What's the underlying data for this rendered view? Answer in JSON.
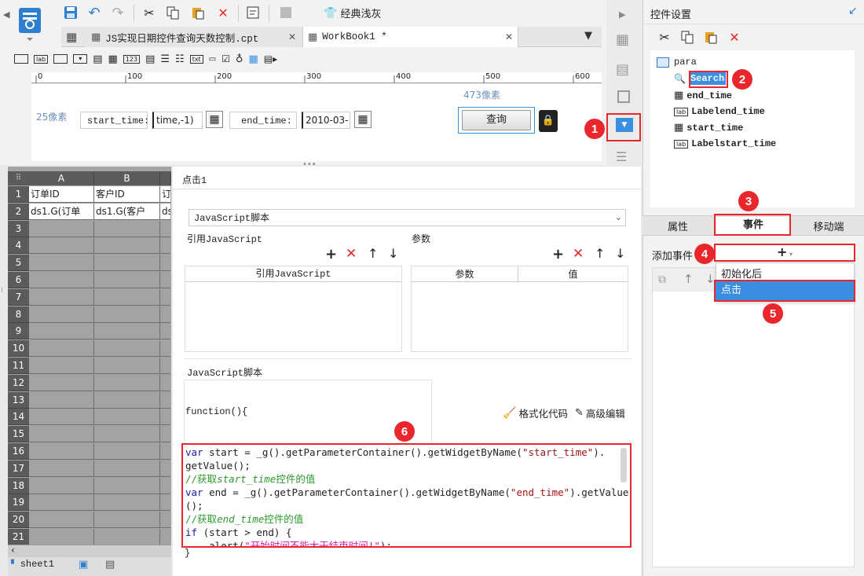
{
  "toolbar": {
    "classic_theme": "经典浅灰"
  },
  "tabs": [
    {
      "label": "JS实现日期控件查询天数控制.cpt",
      "close": "✕"
    },
    {
      "label": "WorkBook1 *",
      "close": "✕"
    }
  ],
  "ruler": {
    "ticks": [
      "0",
      "100",
      "200",
      "300",
      "400",
      "500",
      "600"
    ],
    "left_px": "25像素",
    "right_px": "473像素"
  },
  "params": {
    "start_label": "start_time:",
    "start_value": "time,-1)",
    "end_label": "end_time:",
    "end_value": "2010-03-",
    "query_button": "查询"
  },
  "sheet": {
    "col_headers": [
      "A",
      "B"
    ],
    "rows": [
      {
        "num": "1",
        "a": "订单ID",
        "b": "客户ID",
        "c": "订"
      },
      {
        "num": "2",
        "a": "ds1.G(订单",
        "b": "ds1.G(客户",
        "c": "ds"
      }
    ],
    "empty_rows": [
      "3",
      "4",
      "5",
      "6",
      "7",
      "8",
      "9",
      "10",
      "11",
      "12",
      "13",
      "14",
      "15",
      "16",
      "17",
      "18",
      "19",
      "20",
      "21"
    ],
    "sheet_tab": "sheet1"
  },
  "event_panel": {
    "title": "点击1",
    "script_type": "JavaScript脚本",
    "ref_js_label": "引用JavaScript",
    "params_label": "参数",
    "ref_js_col": "引用JavaScript",
    "param_col": "参数",
    "value_col": "值",
    "script_label": "JavaScript脚本",
    "function_head": "function(){",
    "format_code": "格式化代码",
    "advanced_edit": "高级编辑",
    "code": {
      "l1_kw": "var",
      "l1_a": " start = _g().getParameterContainer().getWidgetByName(",
      "l1_str": "\"start_time\"",
      "l1_b": ").",
      "l2": "getValue();",
      "l3_a": "//获取",
      "l3_b": "start_time",
      "l3_c": "控件的值",
      "l4_kw": "var",
      "l4_a": " end = _g().getParameterContainer().getWidgetByName(",
      "l4_str": "\"end_time\"",
      "l4_b": ").getValue",
      "l5": "();",
      "l6_a": "//获取",
      "l6_b": "end_time",
      "l6_c": "控件的值",
      "l7_kw": "if",
      "l7_a": " (start > end) {",
      "l8_a": "    alert(",
      "l8_str": "\"开始时间不能大于结束时间!\"",
      "l8_b": ");"
    },
    "closing_brace": "}"
  },
  "right_panel": {
    "title": "控件设置",
    "tree": {
      "root": "para",
      "items": [
        "Search",
        "end_time",
        "Labelend_time",
        "start_time",
        "Labelstart_time"
      ]
    },
    "tabs": [
      "属性",
      "事件",
      "移动端"
    ],
    "add_event_label": "添加事件",
    "add_symbol": "+",
    "dropdown_items": [
      "初始化后",
      "点击"
    ]
  },
  "annotations": [
    "1",
    "2",
    "3",
    "4",
    "5",
    "6"
  ],
  "colors": {
    "accent_red": "#e8262c",
    "selection_blue": "#3b8ee0",
    "sheet_gray": "#a3a3a3"
  }
}
